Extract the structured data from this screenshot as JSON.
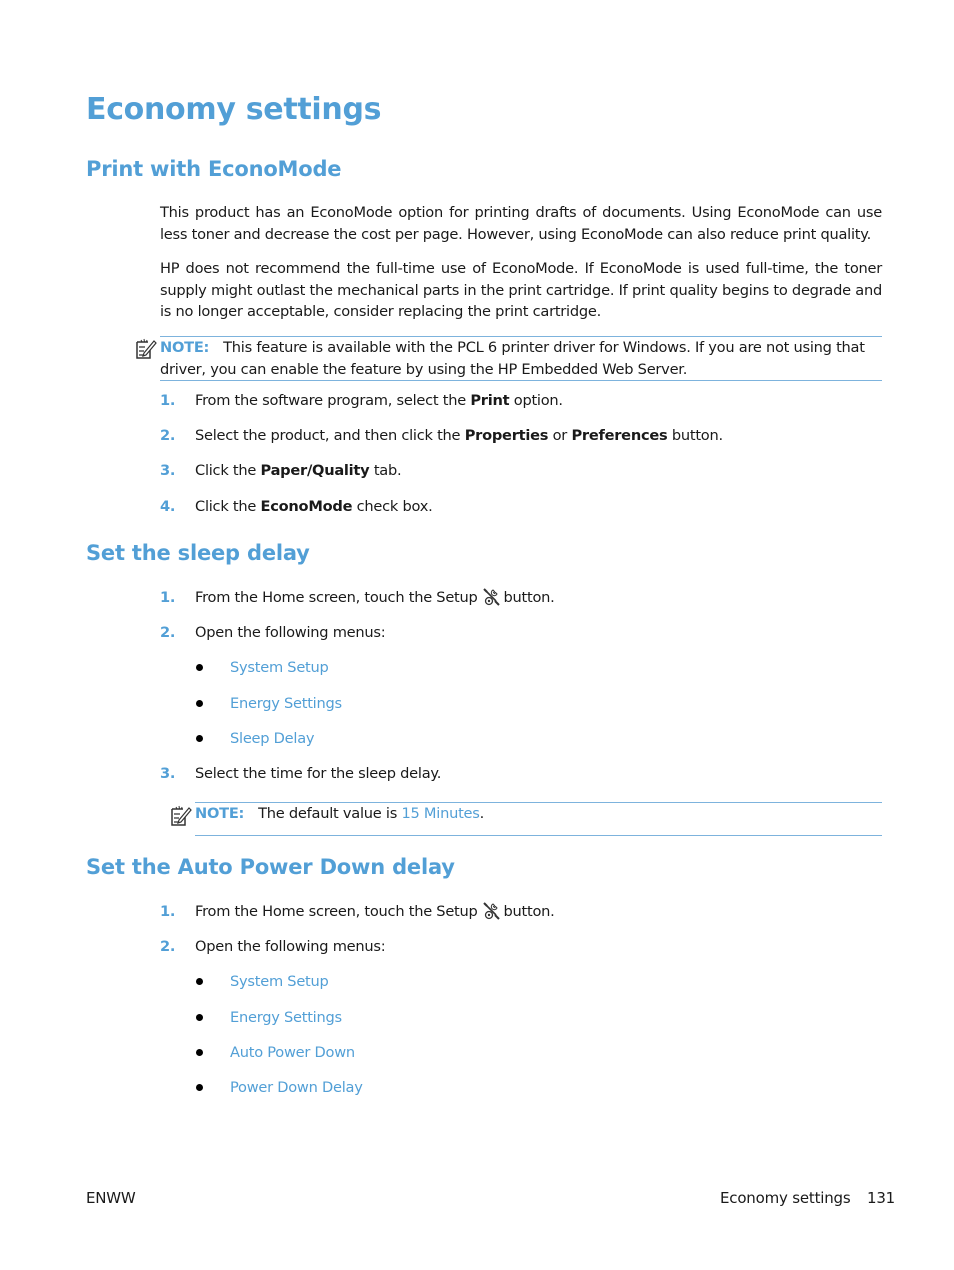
{
  "page_title": "Economy settings",
  "sections": {
    "econo": {
      "heading": "Print with EconoMode",
      "para1": "This product has an EconoMode option for printing drafts of documents. Using EconoMode can use less toner and decrease the cost per page. However, using EconoMode can also reduce print quality.",
      "para2": "HP does not recommend the full-time use of EconoMode. If EconoMode is used full-time, the toner supply might outlast the mechanical parts in the print cartridge. If print quality begins to degrade and is no longer acceptable, consider replacing the print cartridge.",
      "note": {
        "label": "NOTE:",
        "text": "This feature is available with the PCL 6 printer driver for Windows. If you are not using that driver, you can enable the feature by using the HP Embedded Web Server."
      },
      "steps": [
        {
          "num": "1.",
          "pre": "From the software program, select the ",
          "bold": "Print",
          "post": " option."
        },
        {
          "num": "2.",
          "pre": "Select the product, and then click the ",
          "bold": "Properties",
          "mid": " or ",
          "bold2": "Preferences",
          "post": " button."
        },
        {
          "num": "3.",
          "pre": "Click the ",
          "bold": "Paper/Quality",
          "post": " tab."
        },
        {
          "num": "4.",
          "pre": "Click the ",
          "bold": "EconoMode",
          "post": " check box."
        }
      ]
    },
    "sleep": {
      "heading": "Set the sleep delay",
      "steps": [
        {
          "num": "1.",
          "pre": "From the Home screen, touch the Setup",
          "post": "button.",
          "icon": "setup-wrench-icon"
        },
        {
          "num": "2.",
          "text": "Open the following menus:"
        },
        {
          "num": "3.",
          "text": "Select the time for the sleep delay."
        }
      ],
      "menus": [
        "System Setup",
        "Energy Settings",
        "Sleep Delay"
      ],
      "note": {
        "label": "NOTE:",
        "pre": "The default value is ",
        "value": "15 Minutes",
        "post": "."
      }
    },
    "autopower": {
      "heading": "Set the Auto Power Down delay",
      "steps": [
        {
          "num": "1.",
          "pre": "From the Home screen, touch the Setup",
          "post": "button.",
          "icon": "setup-wrench-icon"
        },
        {
          "num": "2.",
          "text": "Open the following menus:"
        }
      ],
      "menus": [
        "System Setup",
        "Energy Settings",
        "Auto Power Down",
        "Power Down Delay"
      ]
    }
  },
  "footer": {
    "left": "ENWW",
    "section": "Economy settings",
    "page_number": "131"
  },
  "colors": {
    "accent": "#529fd6",
    "rule": "#7db3dd",
    "text": "#1a1a1a"
  }
}
